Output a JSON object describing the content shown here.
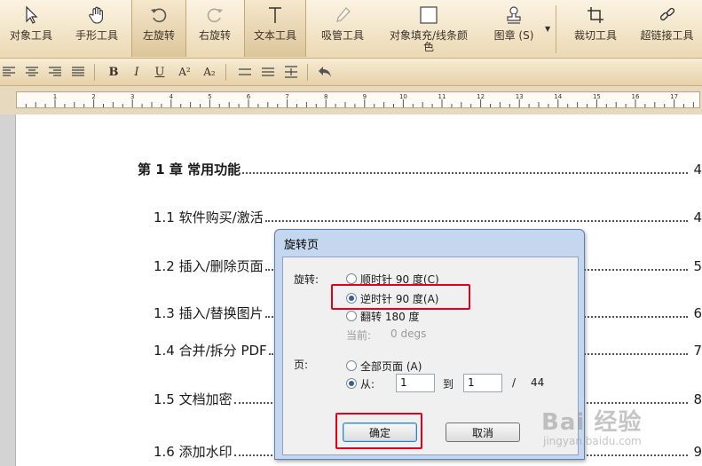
{
  "toolbar": {
    "tools": [
      {
        "label": "对象工具",
        "icon": "pointer-icon"
      },
      {
        "label": "手形工具",
        "icon": "hand-icon"
      },
      {
        "label": "左旋转",
        "icon": "rotate-left-icon",
        "active": true
      },
      {
        "label": "右旋转",
        "icon": "rotate-right-icon",
        "disabled": true
      },
      {
        "label": "文本工具",
        "icon": "text-tool-icon",
        "active": true
      },
      {
        "label": "吸管工具",
        "icon": "eyedropper-icon",
        "disabled": true
      },
      {
        "label": "对象填充/线条颜色",
        "icon": "fill-color-icon"
      },
      {
        "label": "图章 (S)",
        "icon": "stamp-icon"
      },
      {
        "label": "裁切工具",
        "icon": "crop-icon"
      },
      {
        "label": "超链接工具",
        "icon": "hyperlink-icon"
      }
    ]
  },
  "format_bar": {
    "bold": "B",
    "italic": "I",
    "underline": "U",
    "superscript": "A²",
    "subscript": "A₂"
  },
  "ruler": {
    "numbers": [
      "1",
      "2",
      "3",
      "4",
      "5",
      "6",
      "7",
      "8",
      "9",
      "10",
      "11",
      "12",
      "13",
      "14",
      "15",
      "16",
      "17"
    ]
  },
  "document": {
    "toc": [
      {
        "title": "第 1 章  常用功能",
        "page": "4",
        "chapter": true
      },
      {
        "title": "1.1 软件购买/激活",
        "page": "4"
      },
      {
        "title": "1.2 插入/删除页面",
        "page": "5"
      },
      {
        "title": "1.3 插入/替换图片",
        "page": "6"
      },
      {
        "title": "1.4 合并/拆分 PDF",
        "page": "7"
      },
      {
        "title": "1.5 文档加密",
        "page": "8"
      },
      {
        "title": "1.6 添加水印",
        "page": "9"
      }
    ]
  },
  "dialog": {
    "title": "旋转页",
    "rotate_label": "旋转:",
    "clockwise": "顺时针  90  度(C)",
    "counterclockwise": "逆时针  90  度(A)",
    "flip": "翻转  180  度",
    "current_label": "当前:",
    "current_value": "0 degs",
    "pages_label": "页:",
    "all_pages": "全部页面  (A)",
    "from_label": "从:",
    "from_value": "1",
    "to_label": "到",
    "to_value": "1",
    "slash": "/",
    "total_pages": "44",
    "ok": "确定",
    "cancel": "取消",
    "selected_rotation": "counterclockwise",
    "selected_range": "from"
  },
  "watermark": {
    "brand": "Bai 经验",
    "url": "jingyan.baidu.com"
  },
  "colors": {
    "toolbar_bg": "#ecd9b4",
    "highlight_red": "#e3001b",
    "dialog_frame": "#c4d7ee"
  }
}
